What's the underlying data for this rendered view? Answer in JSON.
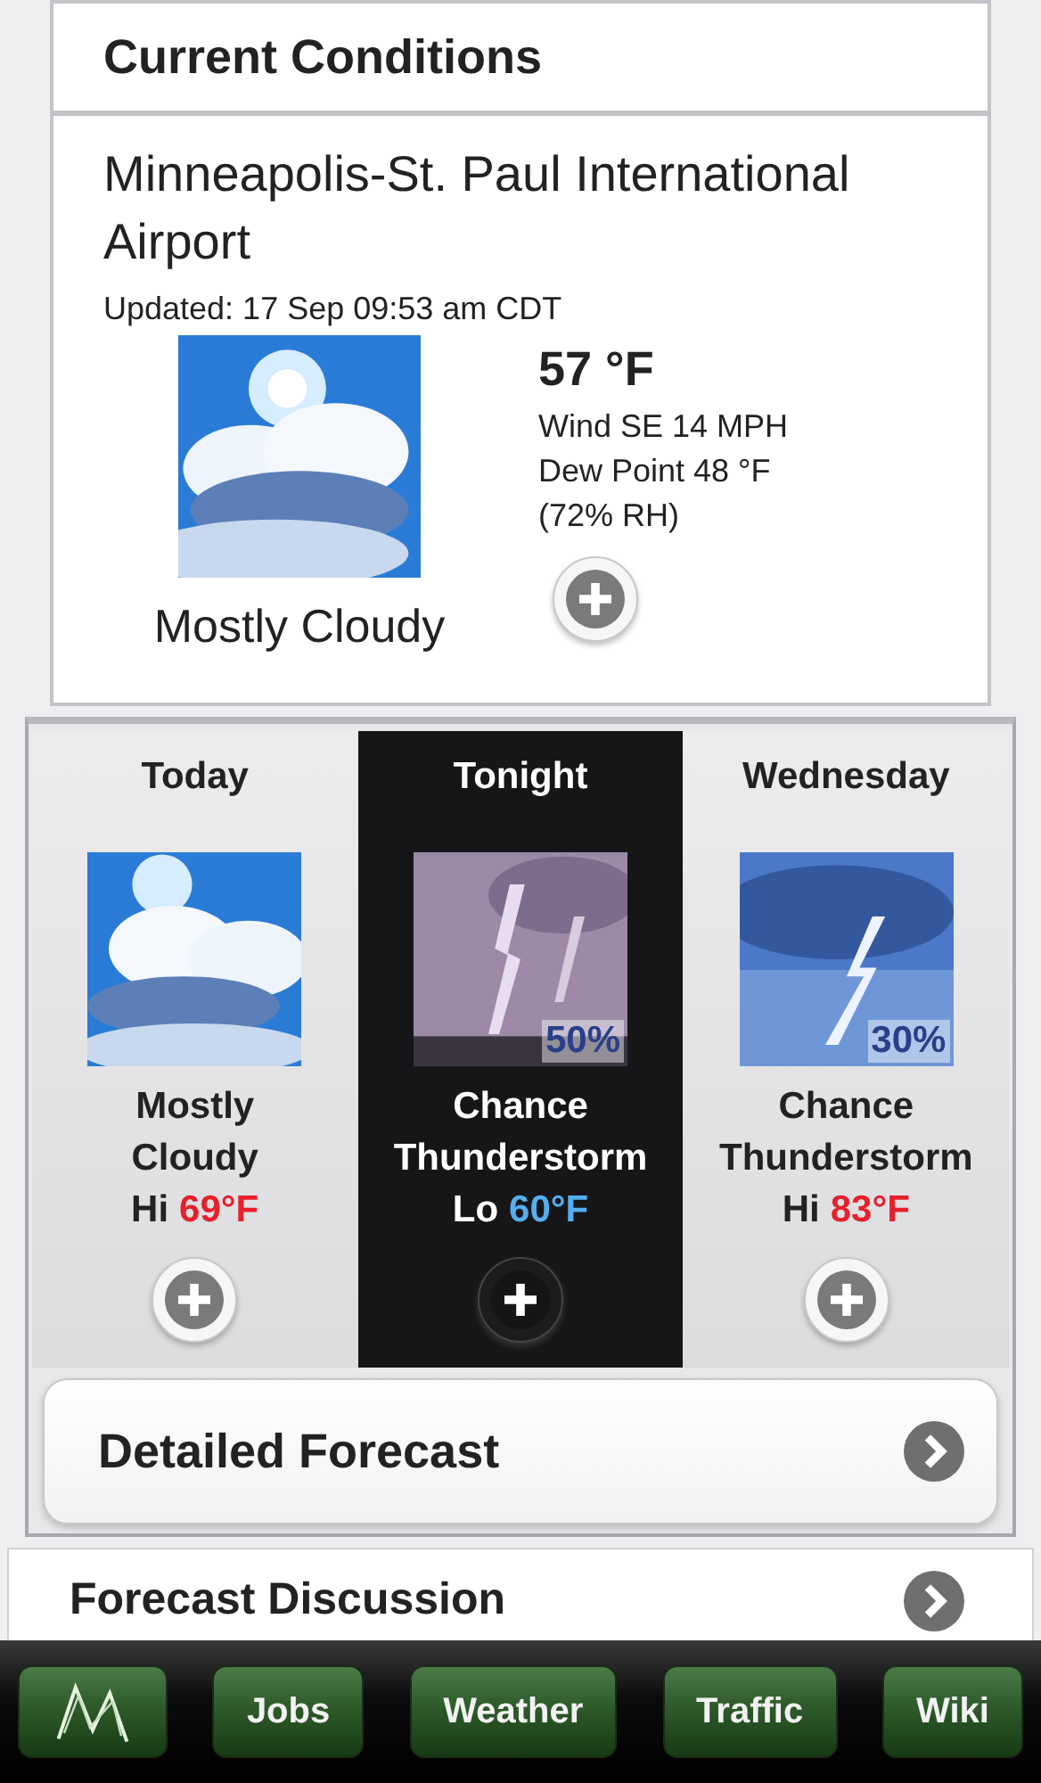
{
  "current": {
    "title": "Current Conditions",
    "station": "Minneapolis-St. Paul International Airport",
    "updated": "Updated: 17 Sep 09:53 am CDT",
    "condition": "Mostly Cloudy",
    "temperature": "57 °F",
    "details": [
      "Wind SE 14 MPH",
      "Dew Point 48 °F",
      "(72% RH)"
    ]
  },
  "forecast": [
    {
      "period": "Today",
      "selected": false,
      "summary": [
        "Mostly",
        "Cloudy"
      ],
      "temp_label": "Hi",
      "temp": "69°F",
      "kind": "hi"
    },
    {
      "period": "Tonight",
      "selected": true,
      "pop": "50%",
      "summary": [
        "Chance",
        "Thunderstorm"
      ],
      "temp_label": "Lo",
      "temp": "60°F",
      "kind": "lo"
    },
    {
      "period": "Wednesday",
      "selected": false,
      "pop": "30%",
      "summary": [
        "Chance",
        "Thunderstorm"
      ],
      "temp_label": "Hi",
      "temp": "83°F",
      "kind": "hi"
    }
  ],
  "detailed_forecast": "Detailed Forecast",
  "forecast_discussion": "Forecast Discussion",
  "tab_bar": [
    "Jobs",
    "Weather",
    "Traffic",
    "Wiki"
  ]
}
